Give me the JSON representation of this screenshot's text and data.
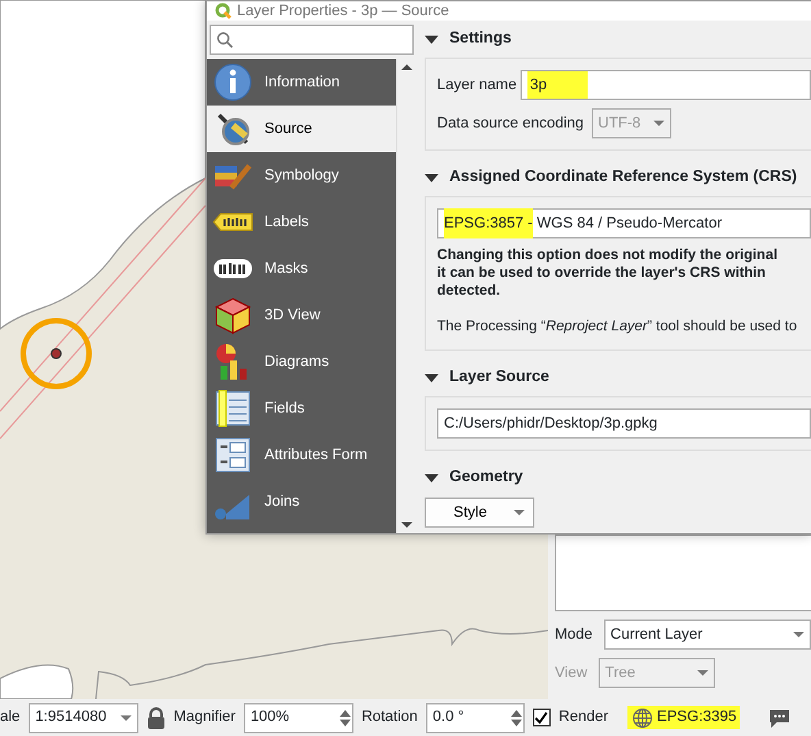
{
  "dialog": {
    "title": "Layer Properties - 3p — Source",
    "sidebar": {
      "items": [
        {
          "label": "Information",
          "kind": "info",
          "selected": false
        },
        {
          "label": "Source",
          "kind": "source",
          "selected": true
        },
        {
          "label": "Symbology",
          "kind": "symbology",
          "selected": false
        },
        {
          "label": "Labels",
          "kind": "labels",
          "selected": false
        },
        {
          "label": "Masks",
          "kind": "masks",
          "selected": false
        },
        {
          "label": "3D View",
          "kind": "cube",
          "selected": false
        },
        {
          "label": "Diagrams",
          "kind": "diagrams",
          "selected": false
        },
        {
          "label": "Fields",
          "kind": "fields",
          "selected": false
        },
        {
          "label": "Attributes Form",
          "kind": "form",
          "selected": false
        },
        {
          "label": "Joins",
          "kind": "joins",
          "selected": false
        }
      ]
    },
    "settings": {
      "title": "Settings",
      "expanded": true,
      "layer_name": {
        "label": "Layer name",
        "value": "3p",
        "highlighted": true
      },
      "encoding": {
        "label": "Data source encoding",
        "value": "UTF-8",
        "disabled": true
      }
    },
    "crs": {
      "title": "Assigned Coordinate Reference System (CRS)",
      "expanded": true,
      "code": "EPSG:3857 -",
      "name": "WGS 84 / Pseudo-Mercator",
      "highlighted": true,
      "warning_lines": [
        "Changing this option does not modify the original",
        "it can be used to override the layer's CRS within",
        "detected."
      ],
      "note": "The Processing “*Reproject Layer*” tool should be used to"
    },
    "layer_source": {
      "title": "Layer Source",
      "expanded": true,
      "path": "C:/Users/phidr/Desktop/3p.gpkg"
    },
    "geometry": {
      "title": "Geometry",
      "expanded": true
    },
    "style_button": "Style"
  },
  "dock": {
    "mode": {
      "label": "Mode",
      "value": "Current Layer"
    },
    "view": {
      "label": "View",
      "value": "Tree",
      "disabled": true
    }
  },
  "status_bar": {
    "scale_label": "ale",
    "scale": "1:9514080",
    "magnifier_label": "Magnifier",
    "magnifier": "100%",
    "rotation_label": "Rotation",
    "rotation": "0.0 °",
    "render": {
      "label": "Render",
      "checked": true
    },
    "crs": {
      "value": "EPSG:3395",
      "highlighted": true
    }
  }
}
